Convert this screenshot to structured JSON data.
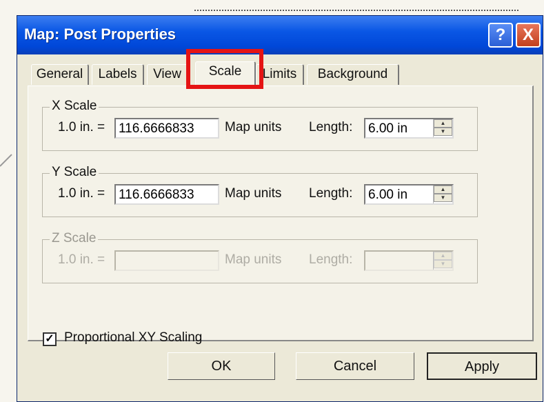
{
  "window": {
    "title": "Map: Post Properties",
    "help_glyph": "?",
    "close_glyph": "X"
  },
  "tabs": [
    {
      "label": "General"
    },
    {
      "label": "Labels"
    },
    {
      "label": "View"
    },
    {
      "label": "Scale"
    },
    {
      "label": "Limits"
    },
    {
      "label": "Background"
    }
  ],
  "x_scale": {
    "legend": "X Scale",
    "prefix": "1.0 in. =",
    "value": "116.6666833",
    "units": "Map units",
    "length_label": "Length:",
    "length": "6.00 in"
  },
  "y_scale": {
    "legend": "Y Scale",
    "prefix": "1.0 in. =",
    "value": "116.6666833",
    "units": "Map units",
    "length_label": "Length:",
    "length": "6.00 in"
  },
  "z_scale": {
    "legend": "Z Scale",
    "prefix": "1.0 in. =",
    "value": "",
    "units": "Map units",
    "length_label": "Length:",
    "length": ""
  },
  "proportional": {
    "label": "Proportional XY Scaling",
    "checked": true,
    "mark": "✓"
  },
  "buttons": {
    "ok": "OK",
    "cancel": "Cancel",
    "apply": "Apply"
  },
  "colors": {
    "title_bar": "#0047d8",
    "highlight": "#e51414",
    "dialog_bg": "#ece9d8"
  }
}
